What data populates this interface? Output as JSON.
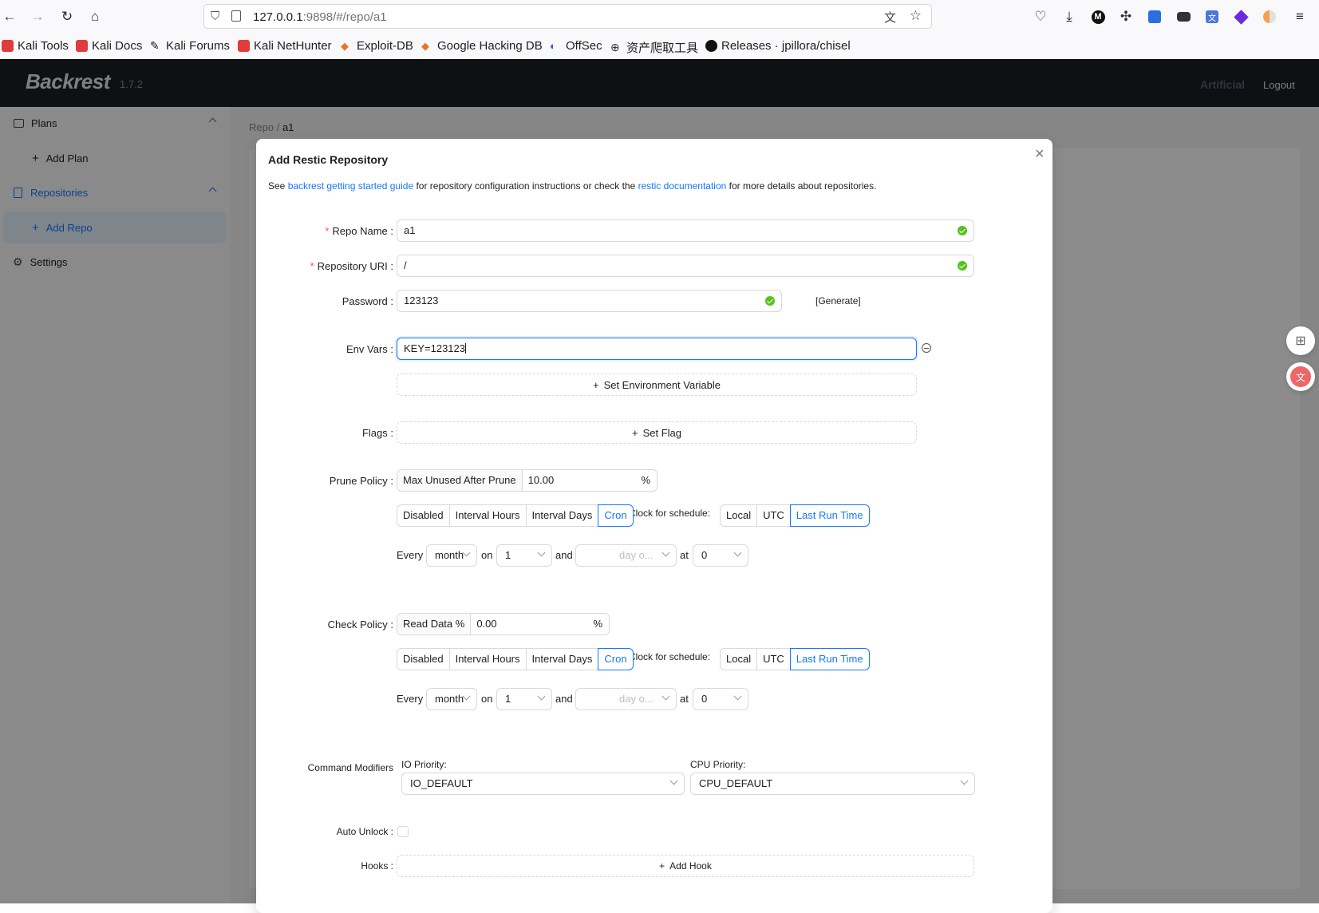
{
  "browser": {
    "url_host": "127.0.0.1",
    "url_rest": ":9898/#/repo/a1",
    "bookmarks": [
      {
        "label": "Kali Tools",
        "icon": "kali-icon"
      },
      {
        "label": "Kali Docs",
        "icon": "kali-icon"
      },
      {
        "label": "Kali Forums",
        "icon": "kali-forums-icon"
      },
      {
        "label": "Kali NetHunter",
        "icon": "kali-icon"
      },
      {
        "label": "Exploit-DB",
        "icon": "exploit-db-icon"
      },
      {
        "label": "Google Hacking DB",
        "icon": "ghdb-icon"
      },
      {
        "label": "OffSec",
        "icon": "offsec-icon"
      },
      {
        "label": "资产爬取工具",
        "icon": "globe-icon"
      },
      {
        "label": "Releases · jpillora/chisel",
        "icon": "github-icon"
      }
    ]
  },
  "app": {
    "logo": "Backrest",
    "version": "1.7.2",
    "host": "Artificial",
    "logout": "Logout",
    "sidebar": {
      "plans": "Plans",
      "add_plan": "Add Plan",
      "repositories": "Repositories",
      "add_repo": "Add Repo",
      "settings": "Settings"
    },
    "breadcrumb": {
      "root": "Repo",
      "sep": "/",
      "current": "a1"
    }
  },
  "modal": {
    "title": "Add Restic Repository",
    "desc_prefix": "See ",
    "desc_link1": "backrest getting started guide",
    "desc_mid": " for repository configuration instructions or check the ",
    "desc_link2": "restic documentation",
    "desc_suffix": " for more details about repositories.",
    "repo_name_label": "Repo Name",
    "repo_name": "a1",
    "uri_label": "Repository URI",
    "uri": "/",
    "password_label": "Password",
    "password": "123123",
    "generate": "[Generate]",
    "env_label": "Env Vars",
    "env_value": "KEY=123123",
    "set_env": "Set Environment Variable",
    "flags_label": "Flags",
    "set_flag": "Set Flag",
    "prune_label": "Prune Policy",
    "prune_prefix": "Max Unused After Prune",
    "prune_value": "10.00",
    "percent": "%",
    "check_label": "Check Policy",
    "check_prefix": "Read Data %",
    "check_value": "0.00",
    "schedule_options": [
      "Disabled",
      "Interval Hours",
      "Interval Days",
      "Cron"
    ],
    "schedule_active": "Cron",
    "clock_label": "Clock for schedule:",
    "clock_options": [
      "Local",
      "UTC",
      "Last Run Time"
    ],
    "clock_active": "Last Run Time",
    "cron": {
      "every": "Every",
      "period": "month",
      "on": "on",
      "day": "1",
      "and": "and",
      "dow_placeholder": "day o...",
      "at": "at",
      "hour": "0"
    },
    "cmd_label": "Command Modifiers",
    "io_label": "IO Priority:",
    "io_value": "IO_DEFAULT",
    "cpu_label": "CPU Priority:",
    "cpu_value": "CPU_DEFAULT",
    "autounlock_label": "Auto Unlock",
    "hooks_label": "Hooks",
    "add_hook": "Add Hook"
  }
}
